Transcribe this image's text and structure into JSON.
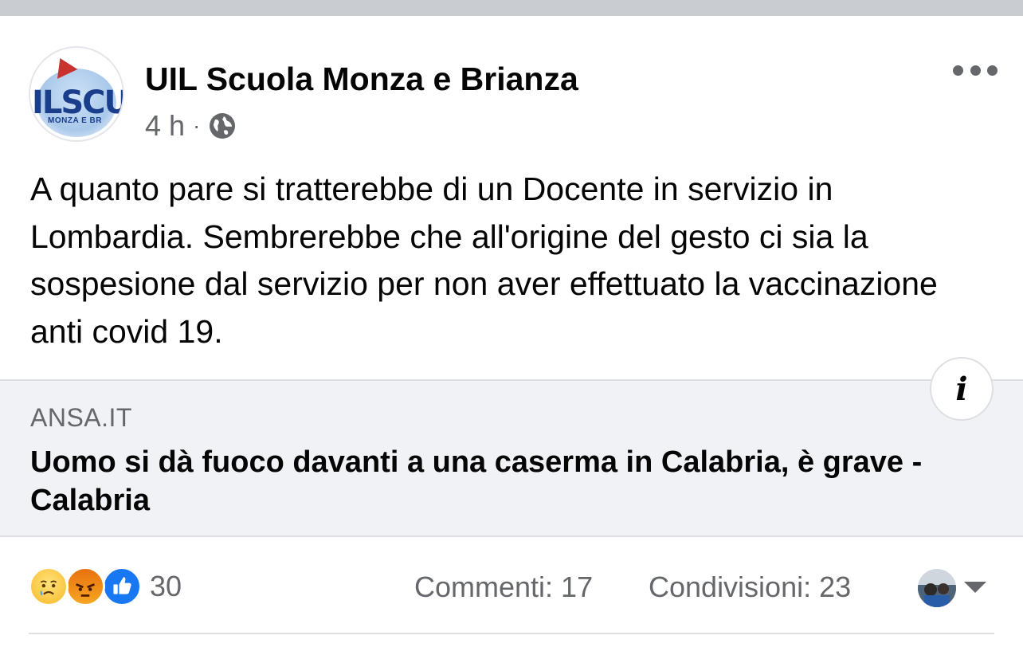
{
  "post": {
    "page_name": "UIL Scuola Monza e Brianza",
    "avatar": {
      "logo_text": "ILSCU(",
      "logo_sub": "MONZA E BR"
    },
    "timestamp": "4 h",
    "separator": "·",
    "privacy_icon": "globe-icon",
    "more_icon": "more-horizontal-icon",
    "text": "A quanto pare si tratterebbe di un Docente in servizio in Lombardia. Sembrerebbe che all'origine del gesto ci sia la sospesione dal servizio per non aver effettuato la vaccinazione anti covid 19."
  },
  "link_preview": {
    "domain": "ANSA.IT",
    "title": "Uomo si dà fuoco davanti a una caserma in Calabria, è grave - Calabria",
    "info_icon": "info-icon"
  },
  "footer": {
    "reactions": [
      "sad",
      "angry",
      "like"
    ],
    "reaction_count": "30",
    "comments": "Commenti: 17",
    "shares": "Condivisioni: 23",
    "viewer_avatar": "viewer-avatar",
    "caret_icon": "caret-down-icon"
  },
  "colors": {
    "background": "#ffffff",
    "top_strip": "#c9ccd1",
    "card_background": "#f0f2f5",
    "secondary_text": "#65676b",
    "like_blue": "#1877f2"
  }
}
